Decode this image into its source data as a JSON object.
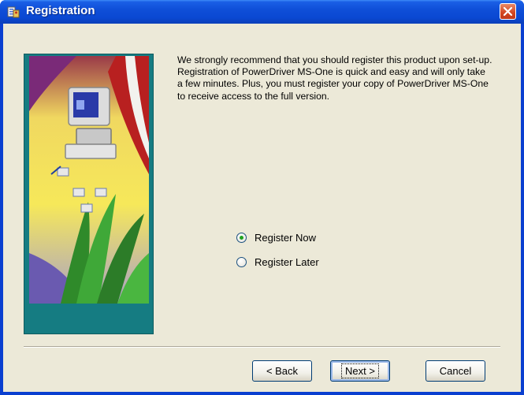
{
  "window": {
    "title": "Registration",
    "title_icon": "registration-app-icon",
    "close_icon": "close-icon"
  },
  "intro_text": "We strongly recommend that you should register this product upon set-up.  Registration of PowerDriver MS-One is quick and easy and will only take a few minutes.  Plus, you must register your copy of PowerDriver MS-One to receive access to the full version.",
  "options": [
    {
      "label": "Register Now",
      "selected": true
    },
    {
      "label": "Register Later",
      "selected": false
    }
  ],
  "buttons": {
    "back": "< Back",
    "next": "Next >",
    "cancel": "Cancel"
  },
  "colors": {
    "titlebar": "#0a48d2",
    "dialog_bg": "#ece9d8",
    "side_panel": "#157c82",
    "close_button": "#d2451f"
  }
}
